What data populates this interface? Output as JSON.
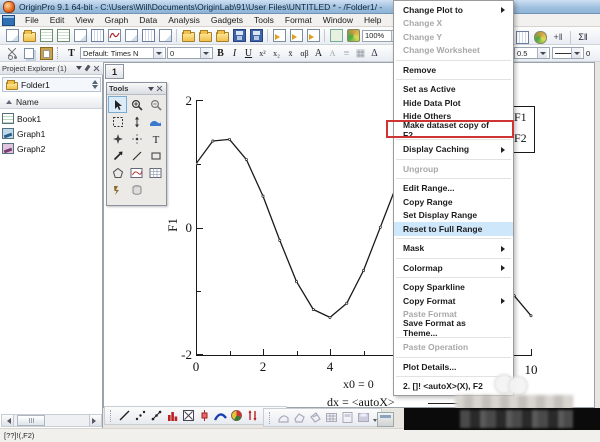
{
  "title_bar": {
    "title": "OriginPro 9.1 64-bit - C:\\Users\\Will\\Documents\\OriginLab\\91\\User Files\\UNTITLED * - /Folder1/ -"
  },
  "menu_bar": {
    "items": [
      "File",
      "Edit",
      "View",
      "Graph",
      "Data",
      "Analysis",
      "Gadgets",
      "Tools",
      "Format",
      "Window",
      "Help"
    ]
  },
  "standard_toolbar": {
    "zoom_value": "100%"
  },
  "format_toolbar": {
    "font_name": "Default: Times N",
    "font_size": "0",
    "buttons": [
      "B",
      "I",
      "U",
      "x²",
      "x₂",
      "x̄",
      "αβ",
      "A",
      "A",
      "Δ"
    ]
  },
  "style_toolbar": {
    "line_width": "0.5",
    "partial_value": "0"
  },
  "project_explorer": {
    "header": "Project Explorer (1)",
    "folder": "Folder1",
    "column_header": "Name",
    "items": [
      {
        "label": "Book1",
        "icon": "workbook-icon"
      },
      {
        "label": "Graph1",
        "icon": "graph-icon"
      },
      {
        "label": "Graph2",
        "icon": "graph-icon"
      }
    ]
  },
  "graph_window": {
    "layer_button": "1",
    "legend": {
      "entries": [
        "F1",
        "F2"
      ]
    },
    "annotations": {
      "x0_label": "x0 = 0",
      "dx_label": "dx = <autoX>"
    }
  },
  "tools_palette": {
    "title": "Tools"
  },
  "context_menu": {
    "annotation_color": "#cf3434",
    "highlight_color": "#cfe7fb",
    "items": [
      {
        "label": "Change Plot to",
        "submenu": true
      },
      {
        "label": "Change X",
        "disabled": true
      },
      {
        "label": "Change Y",
        "disabled": true
      },
      {
        "label": "Change Worksheet",
        "disabled": true
      },
      {
        "label": "Remove"
      },
      {
        "label": "Set as Active"
      },
      {
        "label": "Hide Data Plot"
      },
      {
        "label": "Hide Others"
      },
      {
        "label": "Make dataset copy of F2",
        "annotated": true
      },
      {
        "label": "Display Caching",
        "submenu": true
      },
      {
        "label": "Ungroup",
        "disabled": true
      },
      {
        "label": "Edit Range..."
      },
      {
        "label": "Copy Range"
      },
      {
        "label": "Set Display Range"
      },
      {
        "label": "Reset to Full Range",
        "highlighted": true
      },
      {
        "label": "Mask",
        "submenu": true
      },
      {
        "label": "Colormap",
        "submenu": true
      },
      {
        "label": "Copy Sparkline"
      },
      {
        "label": "Copy Format",
        "submenu": true
      },
      {
        "label": "Paste Format",
        "disabled": true
      },
      {
        "label": "Save Format as Theme..."
      },
      {
        "label": "Paste Operation",
        "disabled": true
      },
      {
        "label": "Plot Details..."
      },
      {
        "label": "2. []! <autoX>(X), F2"
      }
    ]
  },
  "status_bar": {
    "text": "[??]!(,F2)"
  },
  "chart_data": {
    "type": "line",
    "title": "",
    "xlabel": "",
    "ylabel": "F1",
    "xlim": [
      0,
      10
    ],
    "ylim": [
      -2,
      2
    ],
    "x_tick_labels": [
      "0",
      "2",
      "4",
      "6",
      "8",
      "10"
    ],
    "y_tick_labels": [
      "2",
      "0",
      "-2"
    ],
    "legend_entries": [
      "F1",
      "F2"
    ],
    "series": [
      {
        "name": "F1",
        "x": [
          0,
          0.5,
          1,
          1.5,
          2,
          2.5,
          3,
          3.5,
          4,
          4.5,
          5,
          5.5,
          6,
          6.5,
          7,
          7.5,
          8,
          8.5,
          9,
          9.5,
          10
        ],
        "y": [
          1.0,
          1.357,
          1.382,
          1.068,
          0.493,
          -0.202,
          -0.849,
          -1.287,
          -1.41,
          -1.188,
          -0.675,
          0.003,
          0.681,
          1.192,
          1.411,
          1.285,
          0.844,
          0.196,
          -0.499,
          -1.072,
          -1.383
        ]
      }
    ],
    "annotations": [
      "x0 = 0",
      "dx = <autoX>"
    ]
  }
}
